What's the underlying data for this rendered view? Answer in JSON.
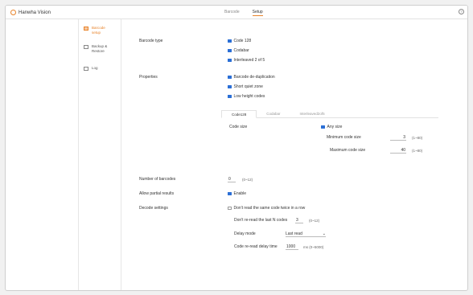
{
  "app": {
    "title": "Hanwha Vision"
  },
  "header": {
    "tabs": [
      "Barcode",
      "Setup"
    ],
    "active_tab": "Setup",
    "help_icon": "?"
  },
  "sidebar": {
    "items": [
      {
        "label": "Barcode setup",
        "icon": "barcode-icon",
        "active": true
      },
      {
        "label": "Backup & Restore",
        "icon": "backup-icon",
        "active": false
      },
      {
        "label": "Log",
        "icon": "log-icon",
        "active": false
      }
    ]
  },
  "barcode_type": {
    "label": "Barcode type",
    "options": [
      {
        "label": "Code 128",
        "checked": true
      },
      {
        "label": "Codabar",
        "checked": true
      },
      {
        "label": "Interleaved 2 of 5",
        "checked": true
      }
    ]
  },
  "properties": {
    "label": "Properties",
    "options": [
      {
        "label": "Barcode de-duplication",
        "checked": true
      },
      {
        "label": "Short quiet zone",
        "checked": true
      },
      {
        "label": "Low height codes",
        "checked": true
      }
    ]
  },
  "code_tabs": {
    "tabs": [
      "Code128",
      "Codabar",
      "Interleaved2of5"
    ],
    "active": "Code128"
  },
  "code_size": {
    "label": "Code size",
    "any_size": {
      "label": "Any size",
      "checked": true
    },
    "min": {
      "label": "Minimum code size",
      "value": "3",
      "range": "(1~80)"
    },
    "max": {
      "label": "Maximum code size",
      "value": "40",
      "range": "(1~80)"
    }
  },
  "number_of_barcodes": {
    "label": "Number of barcodes",
    "value": "0",
    "range": "(0~12)"
  },
  "allow_partial": {
    "label": "Allow partial results",
    "option": {
      "label": "Enable",
      "checked": true
    }
  },
  "decode": {
    "label": "Decode settings",
    "no_repeat": {
      "label": "Don't read the same code twice in a row",
      "checked": false
    },
    "last_n": {
      "label": "Don't re-read the last N codes",
      "value": "3",
      "range": "(0~12)"
    },
    "delay_mode": {
      "label": "Delay mode",
      "value": "Last read"
    },
    "delay_time": {
      "label": "Code re-read delay time",
      "value": "1000",
      "unit": "ms (0~5000)"
    }
  }
}
